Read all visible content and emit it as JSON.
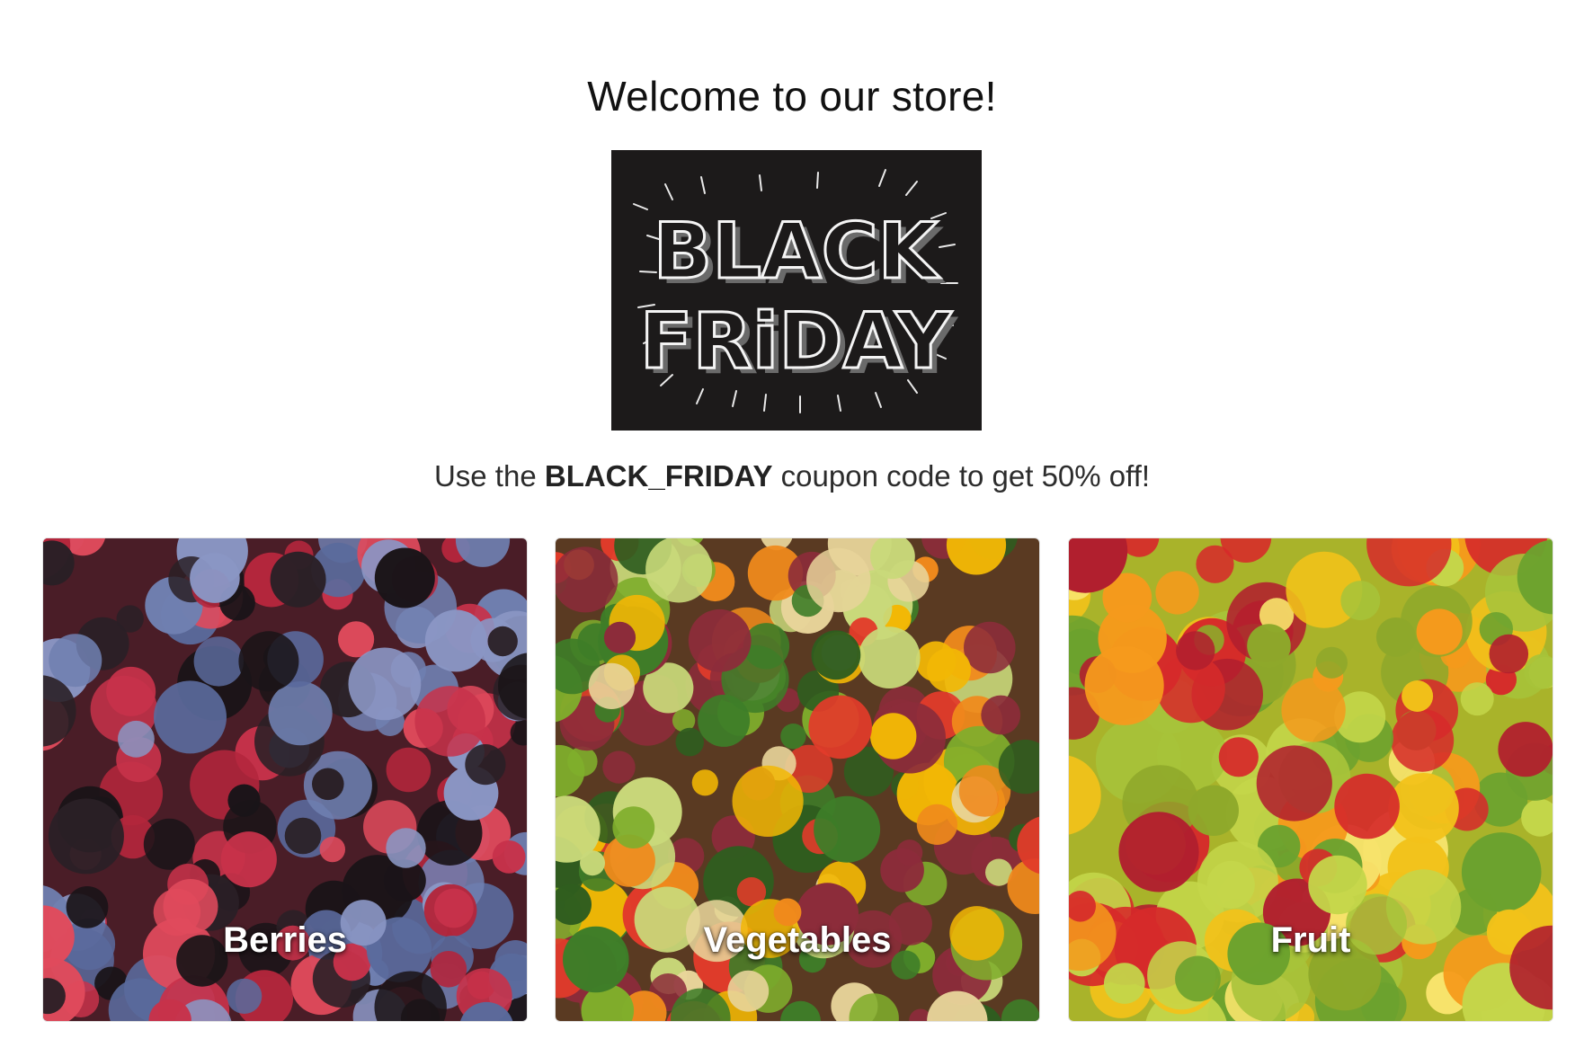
{
  "header": {
    "title": "Welcome to our store!"
  },
  "banner": {
    "line1": "BLACK",
    "line2": "FRiDAY",
    "background": "#1c1a1a"
  },
  "promo": {
    "prefix": "Use the ",
    "code": "BLACK_FRIDAY",
    "suffix": " coupon code to get 50% off!"
  },
  "categories": [
    {
      "label": "Berries",
      "icon": "berries-image"
    },
    {
      "label": "Vegetables",
      "icon": "vegetables-image"
    },
    {
      "label": "Fruit",
      "icon": "fruit-image"
    }
  ]
}
